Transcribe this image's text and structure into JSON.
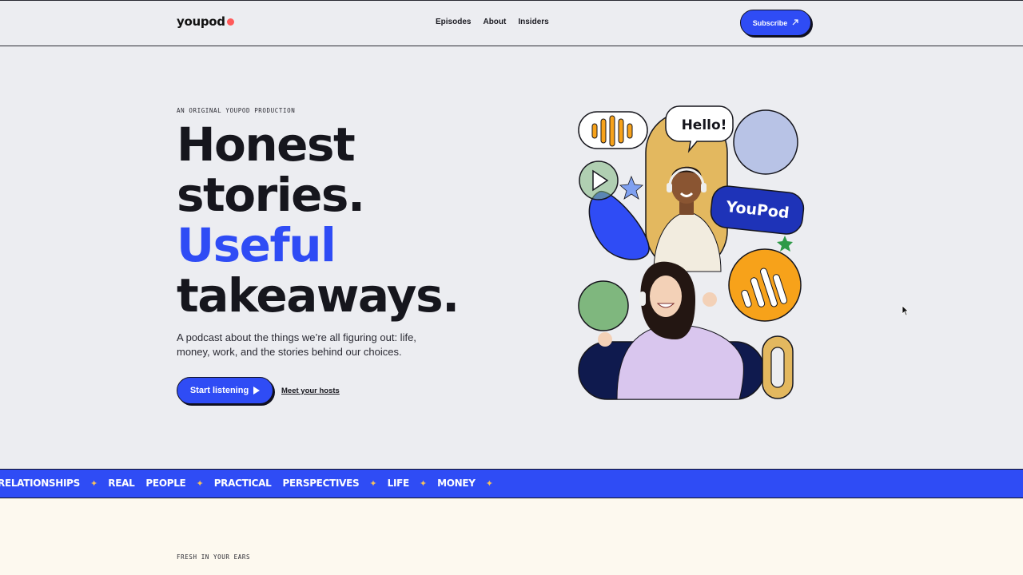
{
  "header": {
    "logo": "youpod",
    "nav": [
      "Episodes",
      "About",
      "Insiders"
    ],
    "subscribe_label": "Subscribe",
    "subscribe_icon": "arrow-up-right-icon"
  },
  "hero": {
    "kicker": "AN ORIGINAL YOUPOD PRODUCTION",
    "headline_1": "Honest",
    "headline_2": "stories.",
    "headline_3": "Useful",
    "headline_4": "takeaways.",
    "description": "A podcast about the things we’re all figuring out: life, money, work, and the stories behind our choices.",
    "start_label": "Start listening",
    "hosts_label": "Meet your hosts"
  },
  "art": {
    "bubble_text": "Hello!",
    "badge_text": "YouPod"
  },
  "marquee": {
    "items": [
      "RELATIONSHIPS",
      "REAL",
      "PEOPLE",
      "PRACTICAL",
      "PERSPECTIVES",
      "LIFE",
      "MONEY"
    ],
    "separator": "✦"
  },
  "section": {
    "kicker": "FRESH IN YOUR EARS"
  },
  "colors": {
    "accent": "#2f4cf5",
    "navy": "#0f1a4e",
    "gold": "#e3b85f",
    "orange": "#f7a21a",
    "green": "#7fb77e",
    "lavender": "#b8c3e6",
    "coral": "#ff5a5a"
  }
}
